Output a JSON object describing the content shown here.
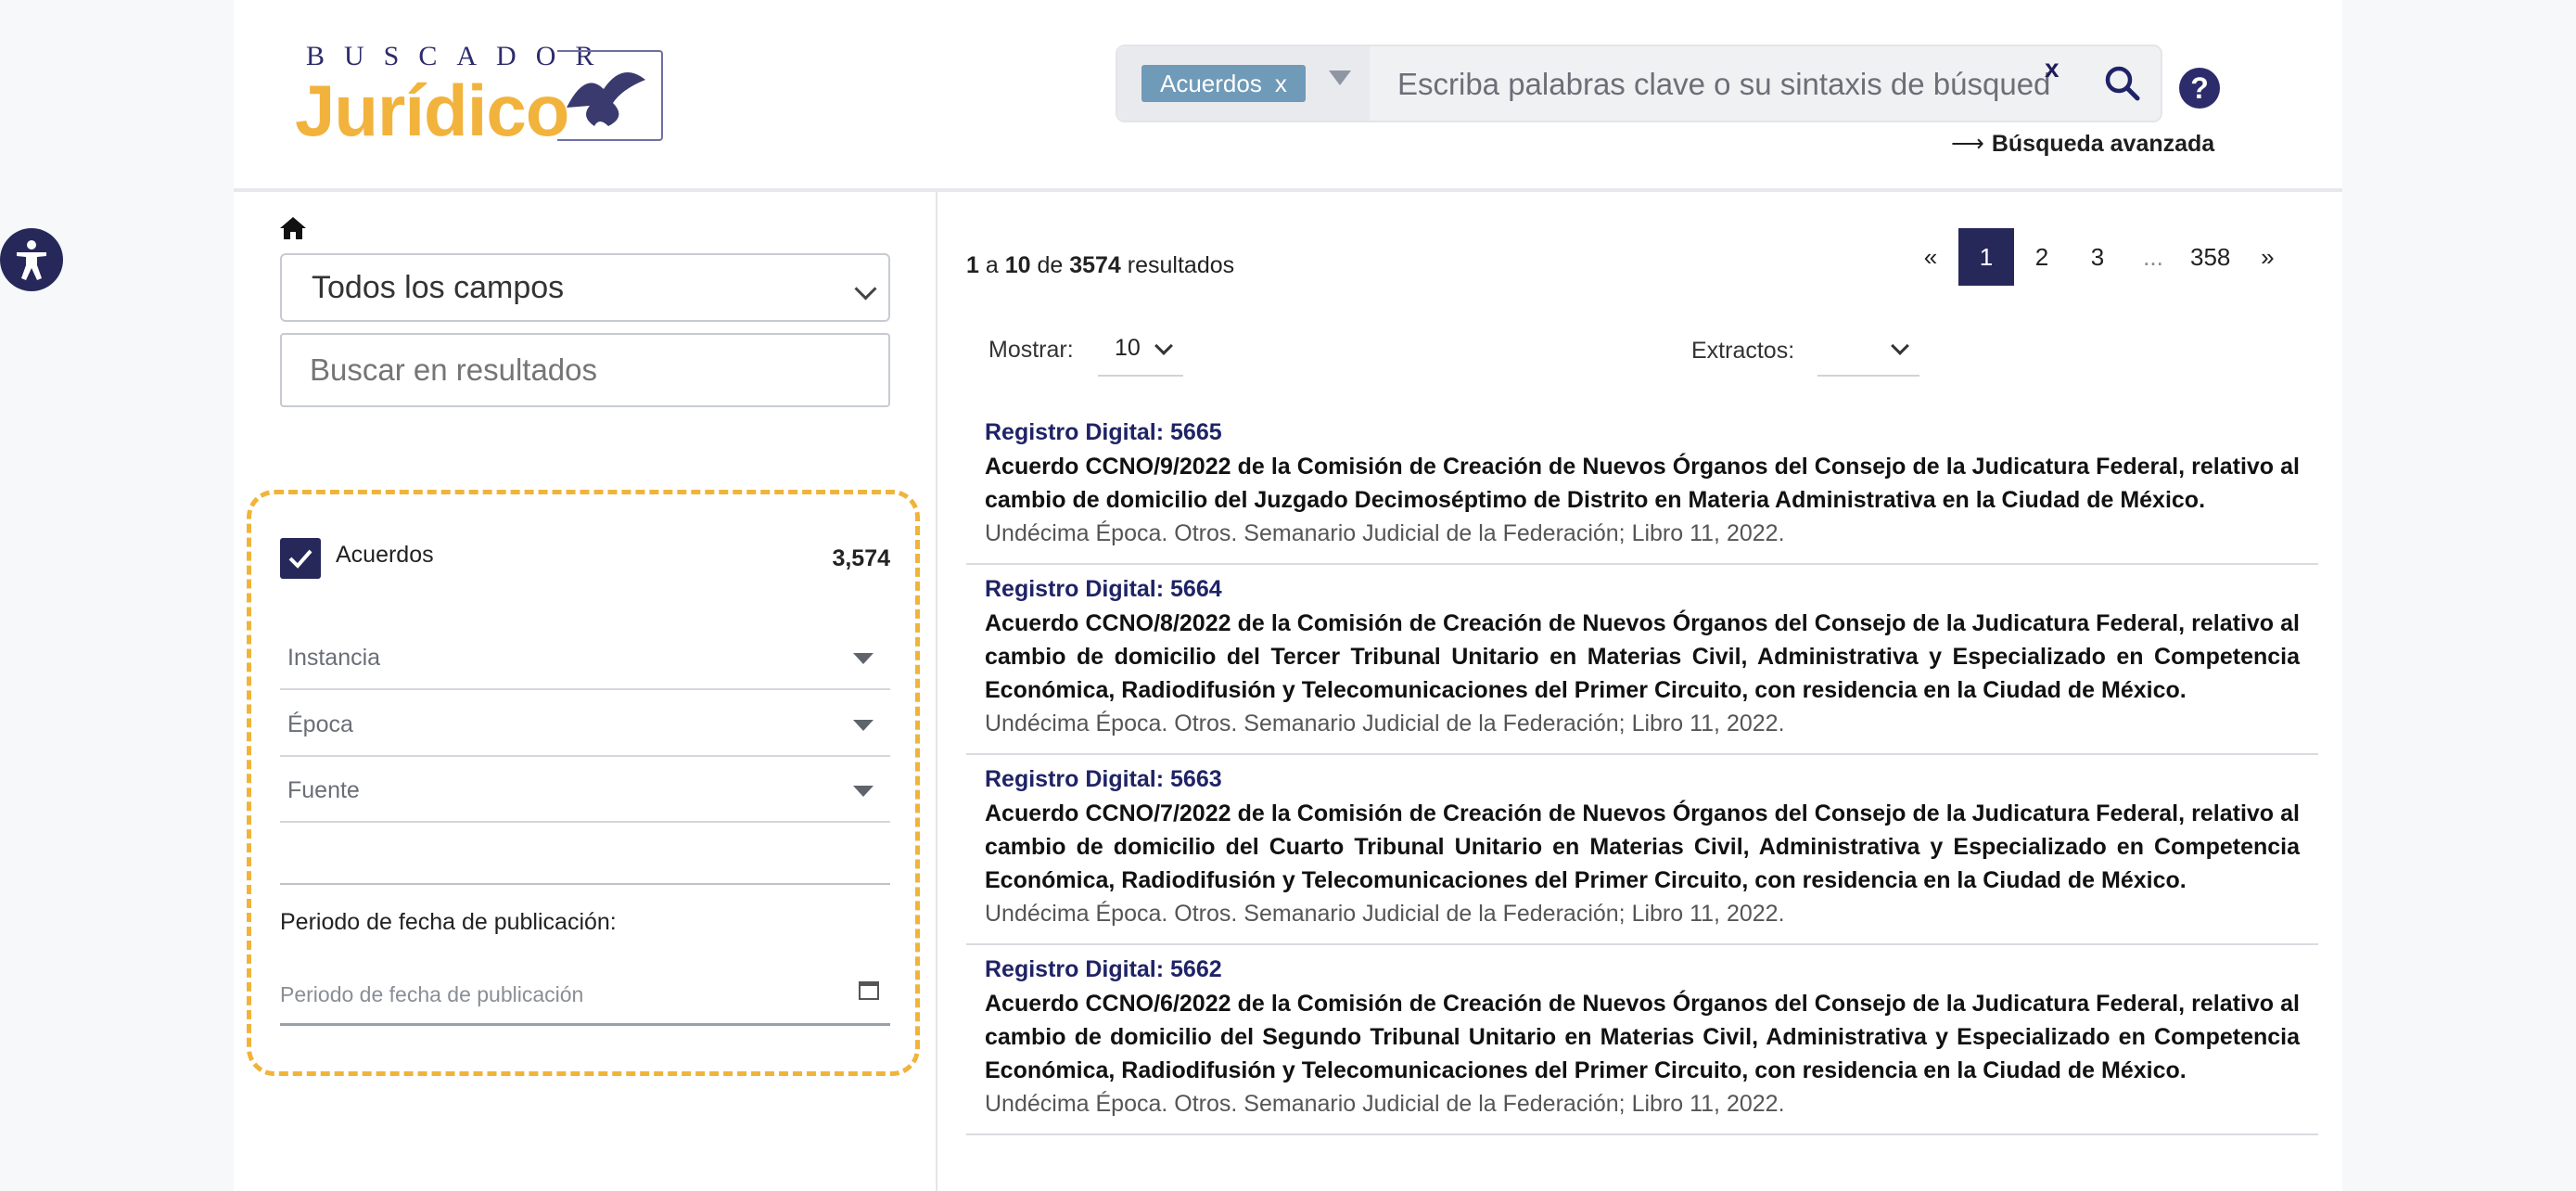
{
  "header": {
    "logo_top": "BUSCADOR",
    "logo_main": "Jurídico",
    "chip_label": "Acuerdos",
    "chip_close": "x",
    "search_placeholder": "Escriba palabras clave o su sintaxis de búsqued",
    "clear_label": "x",
    "help_label": "?",
    "advanced_link": "Búsqueda avanzada",
    "advanced_arrow": "⟶"
  },
  "left_panel": {
    "field_select": "Todos los campos",
    "search_in_results_placeholder": "Buscar en resultados",
    "checkbox_label": "Acuerdos",
    "checkbox_count": "3,574",
    "dropdowns": [
      "Instancia",
      "Época",
      "Fuente"
    ],
    "period_title": "Periodo de fecha de publicación:",
    "period_placeholder": "Periodo de fecha de publicación"
  },
  "results_header": {
    "from": "1",
    "to": "10",
    "total": "3574",
    "sep_a": " a ",
    "sep_de": " de ",
    "suffix": " resultados",
    "show_label": "Mostrar:",
    "show_value": "10",
    "extracts_label": "Extractos:"
  },
  "pagination": [
    "«",
    "1",
    "2",
    "3",
    "...",
    "358",
    "»"
  ],
  "results": [
    {
      "registro": "Registro Digital: 5665",
      "title": "Acuerdo CCNO/9/2022 de la Comisión de Creación de Nuevos Órganos del Consejo de la Judicatura Federal, relativo al cambio de domicilio del Juzgado Decimoséptimo de Distrito en Materia Administrativa en la Ciudad de México.",
      "meta": "Undécima Época. Otros. Semanario Judicial de la Federación; Libro 11, 2022."
    },
    {
      "registro": "Registro Digital: 5664",
      "title": "Acuerdo CCNO/8/2022 de la Comisión de Creación de Nuevos Órganos del Consejo de la Judicatura Federal, relativo al cambio de domicilio del Tercer Tribunal Unitario en Materias Civil, Administrativa y Especializado en Competencia Económica, Radiodifusión y Telecomunicaciones del Primer Circuito, con residencia en la Ciudad de México.",
      "meta": "Undécima Época. Otros. Semanario Judicial de la Federación; Libro 11, 2022."
    },
    {
      "registro": "Registro Digital: 5663",
      "title": "Acuerdo CCNO/7/2022 de la Comisión de Creación de Nuevos Órganos del Consejo de la Judicatura Federal, relativo al cambio de domicilio del Cuarto Tribunal Unitario en Materias Civil, Administrativa y Especializado en Competencia Económica, Radiodifusión y Telecomunicaciones del Primer Circuito, con residencia en la Ciudad de México.",
      "meta": "Undécima Época. Otros. Semanario Judicial de la Federación; Libro 11, 2022."
    },
    {
      "registro": "Registro Digital: 5662",
      "title": "Acuerdo CCNO/6/2022 de la Comisión de Creación de Nuevos Órganos del Consejo de la Judicatura Federal, relativo al cambio de domicilio del Segundo Tribunal Unitario en Materias Civil, Administrativa y Especializado en Competencia Económica, Radiodifusión y Telecomunicaciones del Primer Circuito, con residencia en la Ciudad de México.",
      "meta": "Undécima Época. Otros. Semanario Judicial de la Federación; Libro 11, 2022."
    }
  ],
  "colors": {
    "brand_navy": "#27285a",
    "brand_gold": "#f2b33d",
    "chip": "#6f9ab8",
    "highlight_dashed": "#f0b43a"
  },
  "icons": [
    "accessibility-icon",
    "home-icon",
    "search-icon",
    "help-icon",
    "calendar-icon",
    "check-icon",
    "chevron-down-icon",
    "eagle-seal-icon"
  ]
}
